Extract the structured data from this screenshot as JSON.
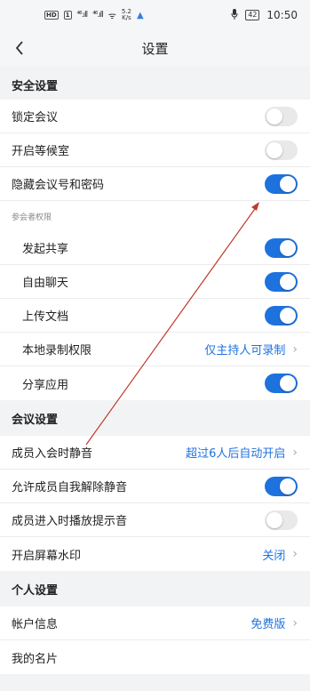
{
  "status_bar": {
    "hd": "HD",
    "sim": "1",
    "signal1": "⁴⁶.ıll",
    "signal2": "⁴⁶.ıll",
    "wifi": "ᯤ",
    "speed_value": "5.2",
    "speed_unit": "K/s",
    "battery": "42",
    "time": "10:50"
  },
  "nav": {
    "title": "设置"
  },
  "sections": {
    "security": {
      "title": "安全设置",
      "lock_meeting": {
        "label": "锁定会议",
        "on": false
      },
      "waiting_room": {
        "label": "开启等候室",
        "on": false
      },
      "hide_id_password": {
        "label": "隐藏会议号和密码",
        "on": true
      },
      "participant_perms": "参会者权限",
      "start_share": {
        "label": "发起共享",
        "on": true
      },
      "free_chat": {
        "label": "自由聊天",
        "on": true
      },
      "upload_doc": {
        "label": "上传文档",
        "on": true
      },
      "local_record": {
        "label": "本地录制权限",
        "value": "仅主持人可录制"
      },
      "share_app": {
        "label": "分享应用",
        "on": true
      }
    },
    "meeting": {
      "title": "会议设置",
      "mute_on_join": {
        "label": "成员入会时静音",
        "value": "超过6人后自动开启"
      },
      "allow_unmute": {
        "label": "允许成员自我解除静音",
        "on": true
      },
      "join_sound": {
        "label": "成员进入时播放提示音",
        "on": false
      },
      "watermark": {
        "label": "开启屏幕水印",
        "value": "关闭"
      }
    },
    "personal": {
      "title": "个人设置",
      "account": {
        "label": "帐户信息",
        "value": "免费版"
      },
      "card": {
        "label": "我的名片"
      }
    }
  },
  "colors": {
    "accent": "#1e72de",
    "toggle_off": "#e9e9ea",
    "annotation": "#c0392b"
  },
  "icons": {
    "back": "back-arrow-icon",
    "chevron": "chevron-right-icon"
  }
}
